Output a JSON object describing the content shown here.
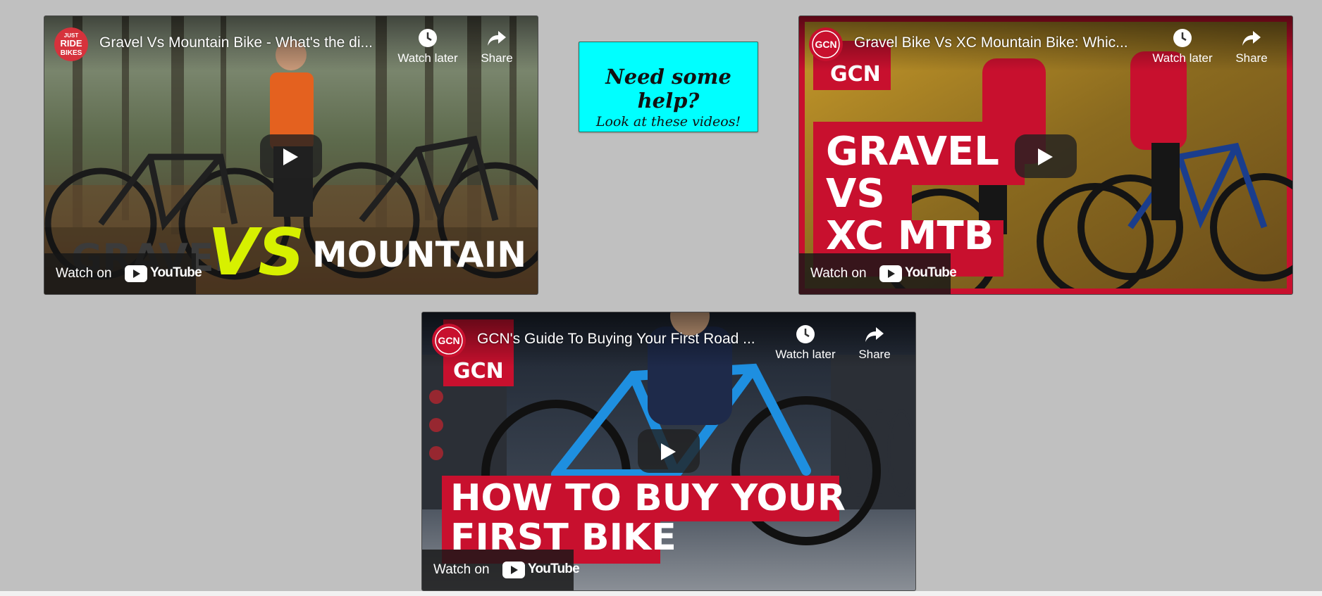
{
  "help_box": {
    "title": "Need some help?",
    "subtitle": "Look at these videos!"
  },
  "videos": [
    {
      "title": "Gravel Vs Mountain Bike - What's the di...",
      "channel_logo_text": "JUST RIDE BIKES",
      "watch_later_label": "Watch later",
      "share_label": "Share",
      "watch_on_label": "Watch on",
      "youtube_label": "YouTube",
      "thumbnail_text": [
        "GRAVEL",
        "VS",
        "MOUNTAIN"
      ]
    },
    {
      "title": "Gravel Bike Vs XC Mountain Bike: Whic...",
      "channel_logo_text": "GCN",
      "watch_later_label": "Watch later",
      "share_label": "Share",
      "watch_on_label": "Watch on",
      "youtube_label": "YouTube",
      "thumbnail_text": [
        "GCN",
        "GRAVEL",
        "VS",
        "XC MTB"
      ]
    },
    {
      "title": "GCN's Guide To Buying Your First Road ...",
      "channel_logo_text": "GCN",
      "watch_later_label": "Watch later",
      "share_label": "Share",
      "watch_on_label": "Watch on",
      "youtube_label": "YouTube",
      "thumbnail_text": [
        "GCN",
        "HOW TO BUY YOUR",
        "FIRST BIKE"
      ]
    }
  ],
  "colors": {
    "page_background": "#c0c0c0",
    "help_box_background": "#00ffff",
    "gcn_red": "#c8102e",
    "vs_yellow": "#d7f000"
  }
}
